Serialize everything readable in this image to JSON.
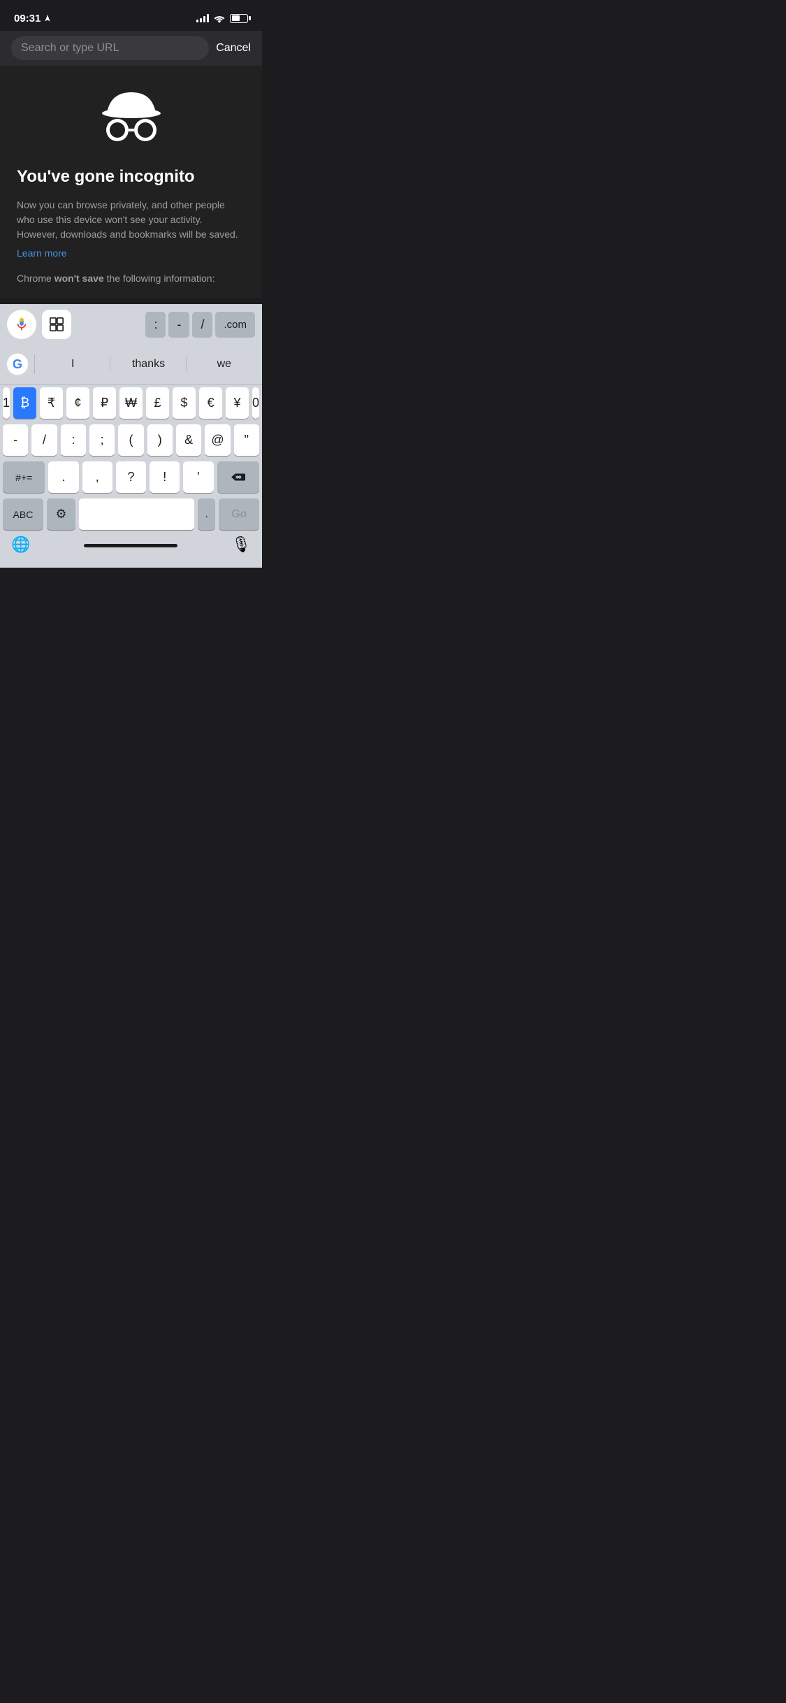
{
  "status_bar": {
    "time": "09:31",
    "nav_arrow": "➤"
  },
  "address_bar": {
    "placeholder": "Search or type URL",
    "cancel_label": "Cancel"
  },
  "incognito": {
    "title": "You've gone incognito",
    "description": "Now you can browse privately, and other people who use this device won't see your activity. However, downloads and bookmarks will be saved.",
    "learn_more": "Learn more",
    "wont_save_prefix": "Chrome ",
    "wont_save_bold": "won't save",
    "wont_save_suffix": " the following information:"
  },
  "keyboard": {
    "toolbar": {
      "mic_icon": "🎤",
      "grid_icon": "⊞",
      "colon": ":",
      "dash": "-",
      "slash": "/",
      "dotcom": ".com"
    },
    "autocomplete": {
      "google_label": "G",
      "option1": "I",
      "option2": "thanks",
      "option3": "we"
    },
    "currency_row": {
      "left_num": "1",
      "keys": [
        "₿",
        "₹",
        "¢",
        "₽",
        "₩",
        "£",
        "$",
        "€",
        "¥"
      ],
      "right_num": "0"
    },
    "symbol_row": [
      "-",
      "/",
      ":",
      ";",
      "(",
      ")",
      "&",
      "@",
      "\""
    ],
    "function_row_left": "#+=",
    "function_row_middle": [
      ".",
      ",",
      "?",
      "!",
      "'"
    ],
    "function_row_right": "⌫",
    "bottom_row": {
      "abc": "ABC",
      "settings": "⚙",
      "space": "",
      "dot": ".",
      "go": "Go"
    },
    "globe": "🌐",
    "mic": "🎙"
  }
}
